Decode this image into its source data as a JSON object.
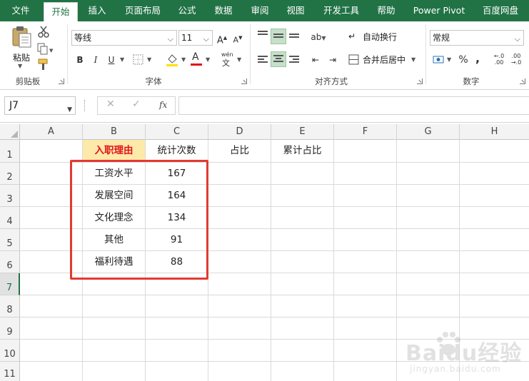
{
  "tabs": [
    "文件",
    "开始",
    "插入",
    "页面布局",
    "公式",
    "数据",
    "审阅",
    "视图",
    "开发工具",
    "帮助",
    "Power Pivot",
    "百度网盘"
  ],
  "ribbon": {
    "clipboard": {
      "paste_label": "粘贴",
      "group_label": "剪贴板"
    },
    "font": {
      "font_name": "等线",
      "font_size": "11",
      "bold": "B",
      "italic": "I",
      "underline": "U",
      "font_color_glyph": "A",
      "phonetic_glyph": "wén",
      "group_label": "字体"
    },
    "alignment": {
      "wrap_text": "自动换行",
      "merge_center": "合并后居中",
      "group_label": "对齐方式"
    },
    "number": {
      "format": "常规",
      "percent": "%",
      "comma": ",",
      "group_label": "数字"
    }
  },
  "formula_bar": {
    "name_box": "J7",
    "cancel": "✕",
    "enter": "✓",
    "fx": "fx",
    "formula": ""
  },
  "columns": [
    "A",
    "B",
    "C",
    "D",
    "E",
    "F",
    "G",
    "H"
  ],
  "rows": [
    "1",
    "2",
    "3",
    "4",
    "5",
    "6",
    "7",
    "8",
    "9",
    "10",
    "11"
  ],
  "cells": {
    "header": {
      "B1": "入职理由",
      "C1": "统计次数",
      "D1": "占比",
      "E1": "累计占比"
    },
    "data": [
      {
        "reason": "工资水平",
        "count": "167"
      },
      {
        "reason": "发展空间",
        "count": "164"
      },
      {
        "reason": "文化理念",
        "count": "134"
      },
      {
        "reason": "其他",
        "count": "91"
      },
      {
        "reason": "福利待遇",
        "count": "88"
      }
    ]
  },
  "watermark": {
    "brand": "Baidu经验",
    "url": "jingyan.baidu.com"
  },
  "colors": {
    "excel_green": "#217346",
    "highlight_fill": "#fde9a9",
    "highlight_text": "#e0131a",
    "annotation_red": "#e23a32"
  }
}
